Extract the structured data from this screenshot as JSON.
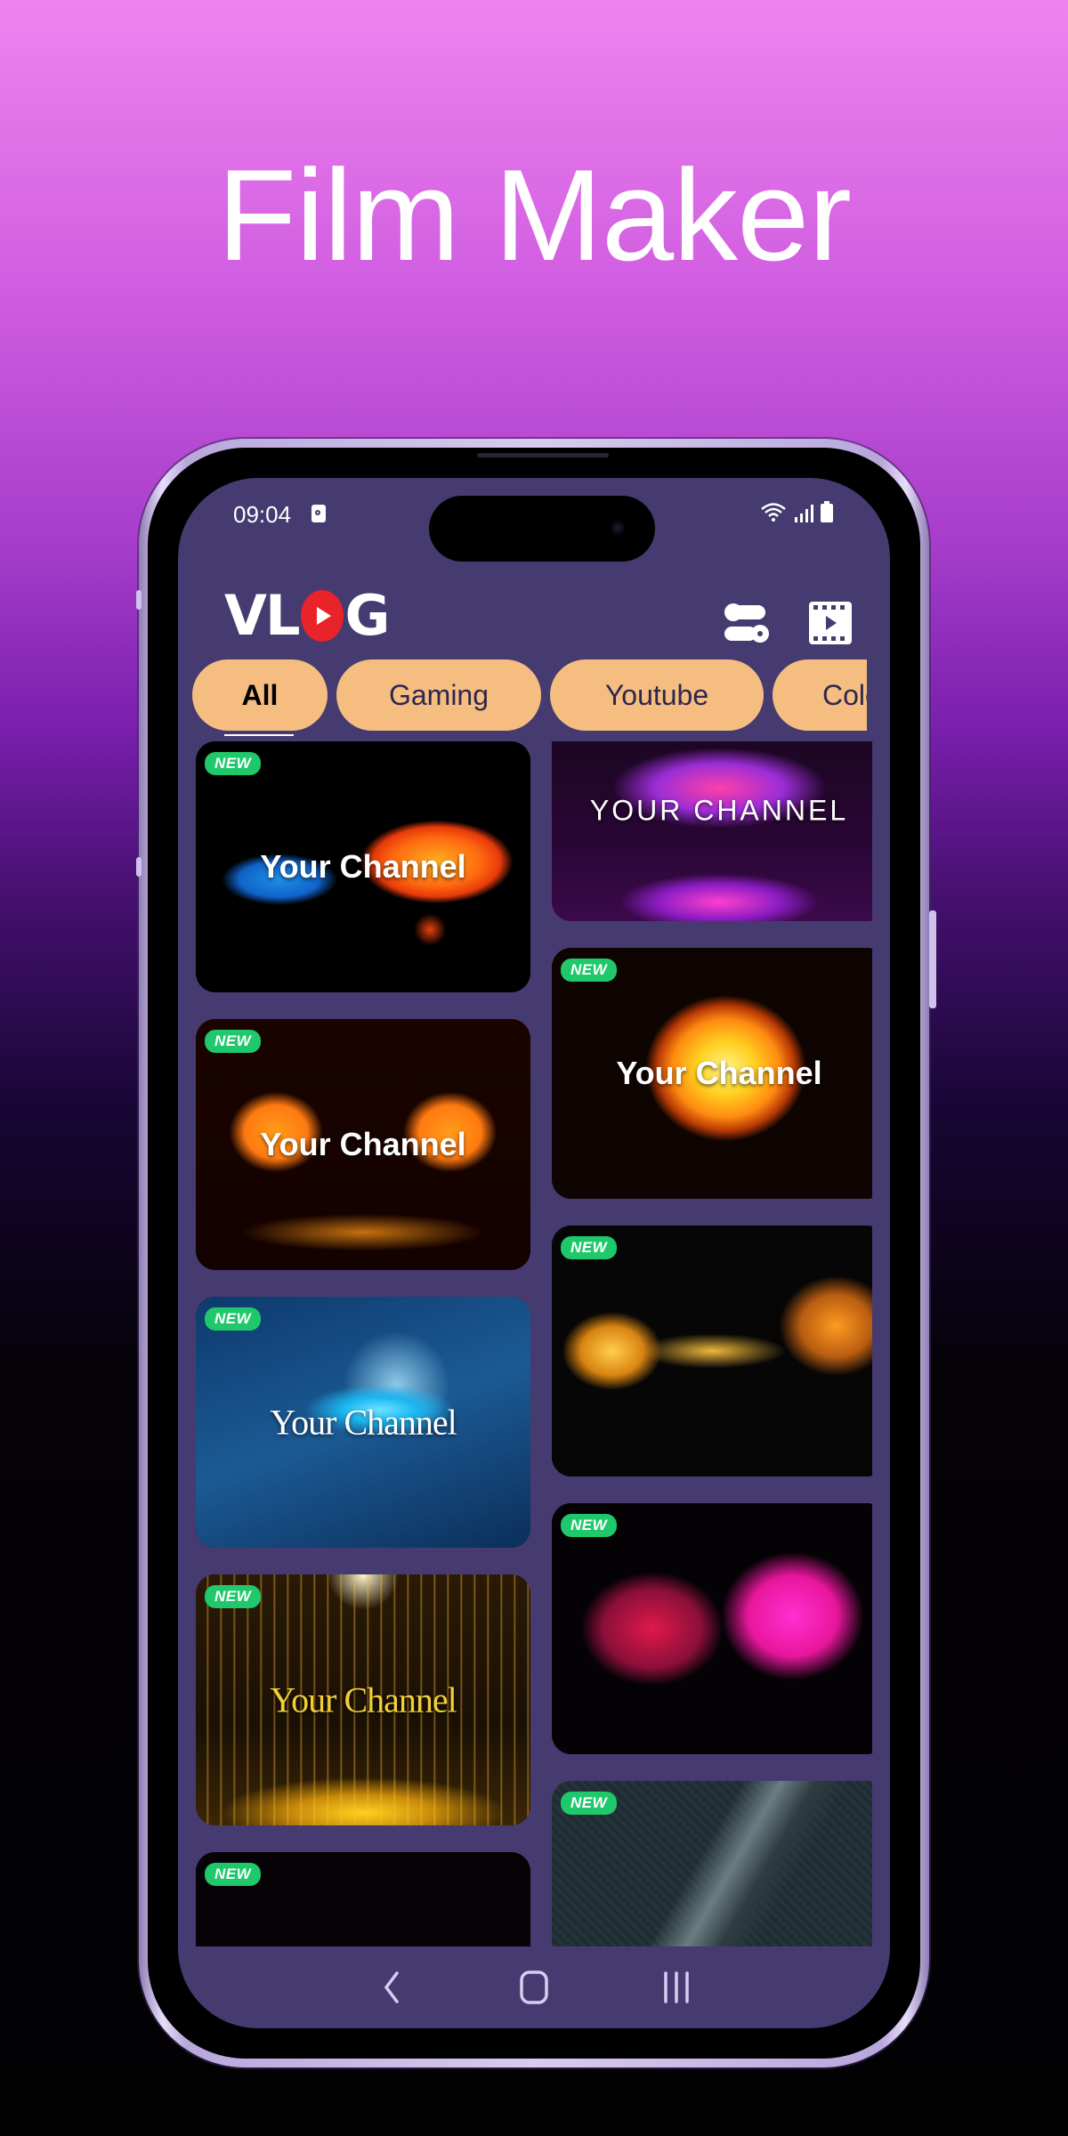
{
  "hero": {
    "title": "Film Maker"
  },
  "status_bar": {
    "time": "09:04",
    "icons": [
      "notification-icon",
      "wifi-icon",
      "signal-icon",
      "battery-icon"
    ]
  },
  "app_bar": {
    "logo": {
      "part1": "VL",
      "part2": "G",
      "brand_color": "#e8232a"
    },
    "actions": [
      {
        "name": "toggle-settings-icon",
        "label": "Settings"
      },
      {
        "name": "video-library-icon",
        "label": "My Videos"
      }
    ]
  },
  "categories": {
    "items": [
      {
        "label": "All",
        "active": true
      },
      {
        "label": "Gaming",
        "active": false
      },
      {
        "label": "Youtube",
        "active": false
      },
      {
        "label": "Color",
        "active": false
      }
    ],
    "chip_color": "#f5be80",
    "text_color": "#2f2650"
  },
  "templates": {
    "badge_label": "NEW",
    "badge_color": "#1fc86a",
    "left_column": [
      {
        "thumb": "blue-orange-tubes",
        "badge": true,
        "title": "Your Channel",
        "style": "sans"
      },
      {
        "thumb": "orange-smoke",
        "badge": true,
        "title": "Your Channel",
        "style": "sans"
      },
      {
        "thumb": "blue-particle-ring",
        "badge": true,
        "title": "Your Channel",
        "style": "serif"
      },
      {
        "thumb": "gold-glitter-rain",
        "badge": true,
        "title": "Your Channel",
        "style": "serif-gold"
      },
      {
        "thumb": "pink-ink-smoke",
        "badge": true,
        "title": "",
        "style": "none"
      }
    ],
    "right_column": [
      {
        "thumb": "neon-light-strokes",
        "badge": false,
        "title": "YOUR CHANNEL",
        "style": "caps"
      },
      {
        "thumb": "fire-explosion",
        "badge": true,
        "title": "Your Channel",
        "style": "sans"
      },
      {
        "thumb": "golden-particle-stream",
        "badge": true,
        "title": "",
        "style": "none"
      },
      {
        "thumb": "magenta-ink-cloud",
        "badge": true,
        "title": "",
        "style": "none"
      },
      {
        "thumb": "metal-weapon-closeup",
        "badge": true,
        "title": "",
        "style": "none"
      }
    ]
  },
  "nav_bar": {
    "items": [
      "back",
      "home",
      "recents"
    ]
  },
  "colors": {
    "screen_bg": "#463b70",
    "nav_icon": "#d7cdf2"
  }
}
